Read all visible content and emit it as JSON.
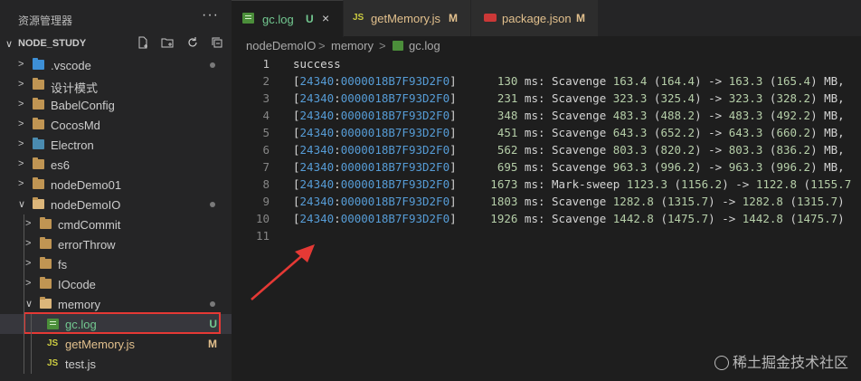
{
  "sidebar": {
    "title": "资源管理器",
    "more": "···",
    "section": {
      "chevron": "∨",
      "label": "NODE_STUDY"
    },
    "actions": [
      "new-file-icon",
      "new-folder-icon",
      "refresh-icon",
      "collapse-all-icon"
    ],
    "tree": [
      {
        "name": ".vscode",
        "type": "folder-blue",
        "depth": 1,
        "expanded": false,
        "dot": true
      },
      {
        "name": "设计模式",
        "type": "folder",
        "depth": 1,
        "expanded": false
      },
      {
        "name": "BabelConfig",
        "type": "folder",
        "depth": 1,
        "expanded": false
      },
      {
        "name": "CocosMd",
        "type": "folder",
        "depth": 1,
        "expanded": false
      },
      {
        "name": "Electron",
        "type": "folder-gray",
        "depth": 1,
        "expanded": false
      },
      {
        "name": "es6",
        "type": "folder",
        "depth": 1,
        "expanded": false
      },
      {
        "name": "nodeDemo01",
        "type": "folder",
        "depth": 1,
        "expanded": false
      },
      {
        "name": "nodeDemoIO",
        "type": "folder-open",
        "depth": 1,
        "expanded": true,
        "dot": true
      },
      {
        "name": "cmdCommit",
        "type": "folder",
        "depth": 2,
        "expanded": false
      },
      {
        "name": "errorThrow",
        "type": "folder",
        "depth": 2,
        "expanded": false
      },
      {
        "name": "fs",
        "type": "folder",
        "depth": 2,
        "expanded": false
      },
      {
        "name": "IOcode",
        "type": "folder",
        "depth": 2,
        "expanded": false
      },
      {
        "name": "memory",
        "type": "folder-open",
        "depth": 2,
        "expanded": true,
        "dot": true
      },
      {
        "name": "gc.log",
        "type": "log",
        "depth": 3,
        "badge": "U",
        "badge_color": "#73c991",
        "name_color": "#73c991",
        "selected": true
      },
      {
        "name": "getMemory.js",
        "type": "js",
        "depth": 3,
        "badge": "M",
        "badge_color": "#e2c08d",
        "name_color": "#e2c08d"
      },
      {
        "name": "test.js",
        "type": "js",
        "depth": 3
      }
    ]
  },
  "tabs": [
    {
      "name": "gc.log",
      "status": "U",
      "active": true,
      "icon": "log",
      "color": "#73c991",
      "close": "×"
    },
    {
      "name": "getMemory.js",
      "status": "M",
      "active": false,
      "icon": "js",
      "color": "#e2c08d"
    },
    {
      "name": "package.json",
      "status": "M",
      "active": false,
      "icon": "package",
      "color": "#e2c08d"
    }
  ],
  "breadcrumb": [
    "nodeDemoIO",
    "memory",
    "gc.log"
  ],
  "breadcrumb_sep": ">",
  "js_label": "JS",
  "code_lines": [
    "success",
    "[24340:0000018B7F93D2F0]      130 ms: Scavenge 163.4 (164.4) -> 163.3 (165.4) MB,",
    "[24340:0000018B7F93D2F0]      231 ms: Scavenge 323.3 (325.4) -> 323.3 (328.2) MB,",
    "[24340:0000018B7F93D2F0]      348 ms: Scavenge 483.3 (488.2) -> 483.3 (492.2) MB,",
    "[24340:0000018B7F93D2F0]      451 ms: Scavenge 643.3 (652.2) -> 643.3 (660.2) MB,",
    "[24340:0000018B7F93D2F0]      562 ms: Scavenge 803.3 (820.2) -> 803.3 (836.2) MB,",
    "[24340:0000018B7F93D2F0]      695 ms: Scavenge 963.3 (996.2) -> 963.3 (996.2) MB,",
    "[24340:0000018B7F93D2F0]     1673 ms: Mark-sweep 1123.3 (1156.2) -> 1122.8 (1155.7",
    "[24340:0000018B7F93D2F0]     1803 ms: Scavenge 1282.8 (1315.7) -> 1282.8 (1315.7)",
    "[24340:0000018B7F93D2F0]     1926 ms: Scavenge 1442.8 (1475.7) -> 1442.8 (1475.7)",
    ""
  ],
  "watermark": "稀土掘金技术社区",
  "colors": {
    "annotation_red": "#e53935",
    "number": "#b5cea8",
    "hex": "#569cd6"
  }
}
